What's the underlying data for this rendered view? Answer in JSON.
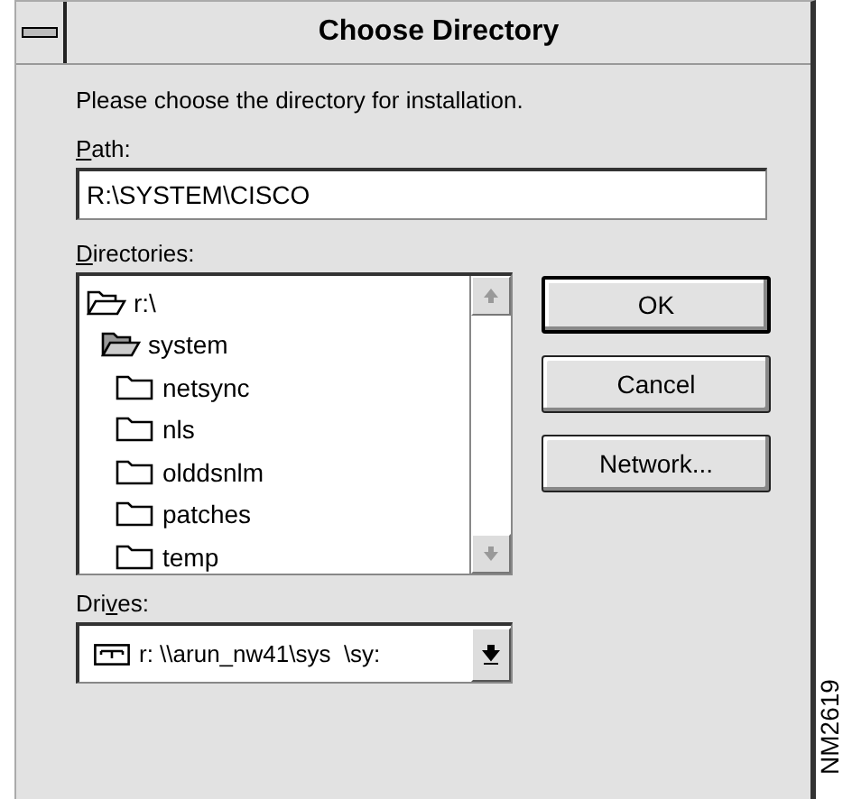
{
  "window": {
    "title": "Choose Directory"
  },
  "prompt": "Please choose the directory for installation.",
  "path": {
    "label": {
      "key": "P",
      "post": "ath:"
    },
    "value": "R:\\SYSTEM\\CISCO"
  },
  "directories": {
    "label": {
      "key": "D",
      "post": "irectories:"
    },
    "tree": [
      {
        "name": "r:\\",
        "kind": "open",
        "children": [
          {
            "name": "system",
            "kind": "current",
            "children": [
              {
                "name": "netsync",
                "kind": "closed"
              },
              {
                "name": "nls",
                "kind": "closed"
              },
              {
                "name": "olddsnlm",
                "kind": "closed"
              },
              {
                "name": "patches",
                "kind": "closed"
              },
              {
                "name": "temp",
                "kind": "closed"
              }
            ]
          }
        ]
      }
    ]
  },
  "buttons": [
    {
      "label": "OK",
      "default": true
    },
    {
      "label": "Cancel",
      "default": false
    },
    {
      "label": "Network...",
      "default": false
    }
  ],
  "drives": {
    "label": {
      "pre": "Dri",
      "key": "v",
      "post": "es:"
    },
    "value": "r: \\\\arun_nw41\\sys  \\sy:"
  },
  "figure_id": "NM2619"
}
